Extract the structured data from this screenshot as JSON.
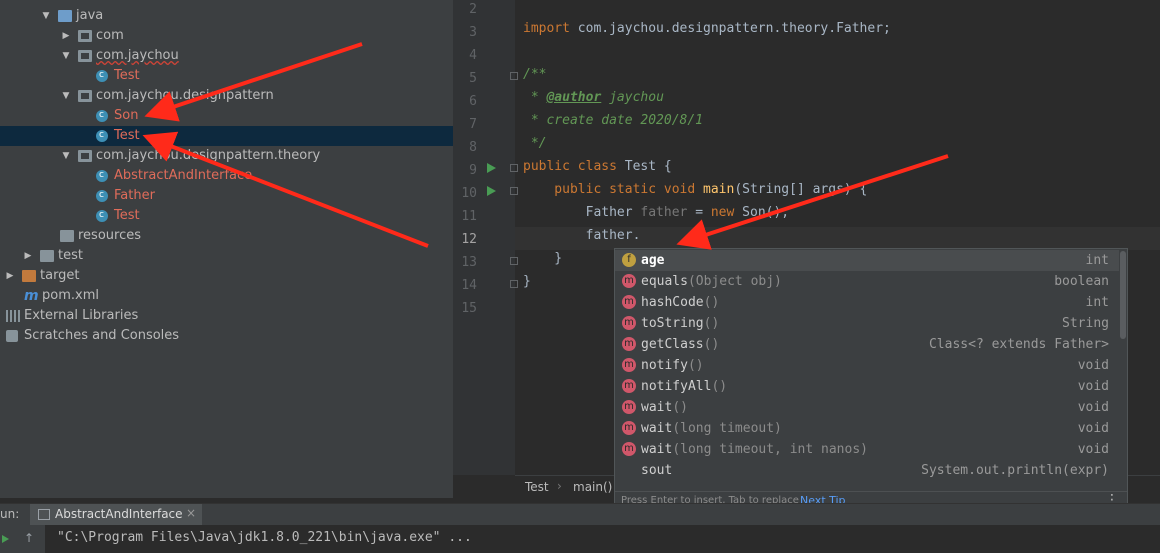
{
  "project_tree": [
    {
      "label": "java",
      "icon": "java-folder-icon",
      "expanded": true
    },
    {
      "label": "com",
      "icon": "package-icon",
      "expanded": false
    },
    {
      "label": "com.jaychou",
      "icon": "package-icon",
      "expanded": true
    },
    {
      "label": "Test",
      "icon": "class-icon"
    },
    {
      "label": "com.jaychou.designpattern",
      "icon": "package-icon",
      "expanded": true
    },
    {
      "label": "Son",
      "icon": "class-icon"
    },
    {
      "label": "Test",
      "icon": "class-icon",
      "selected": true
    },
    {
      "label": "com.jaychou.designpattern.theory",
      "icon": "package-icon",
      "expanded": true
    },
    {
      "label": "AbstractAndInterface",
      "icon": "class-icon"
    },
    {
      "label": "Father",
      "icon": "class-icon"
    },
    {
      "label": "Test",
      "icon": "class-icon"
    },
    {
      "label": "resources",
      "icon": "resources-folder-icon"
    },
    {
      "label": "test",
      "icon": "folder-icon",
      "expanded": false
    },
    {
      "label": "target",
      "icon": "target-folder-icon",
      "expanded": false
    },
    {
      "label": "pom.xml",
      "icon": "maven-icon"
    },
    {
      "label": "External Libraries",
      "icon": "libraries-icon",
      "expanded": false
    },
    {
      "label": "Scratches and Consoles",
      "icon": "scratches-icon",
      "expanded": false
    }
  ],
  "editor": {
    "line_numbers": [
      "2",
      "3",
      "4",
      "5",
      "6",
      "7",
      "8",
      "9",
      "10",
      "11",
      "12",
      "13",
      "14",
      "15"
    ],
    "current_line": "12",
    "code": {
      "import_kw": "import",
      "import_path": " com.jaychou.designpattern.theory.Father;",
      "doc_open": "/**",
      "doc_star1": " * ",
      "doc_author_tag": "@author",
      "doc_author_name": " jaychou",
      "doc_date": " * create date 2020/8/1",
      "doc_close": " */",
      "class_mods": "public class",
      "class_name": " Test {",
      "main_mods": "    public static void",
      "main_name": " main",
      "main_args": "(String[] args) {",
      "father_type": "        Father ",
      "father_var": "father",
      "father_eq": " = ",
      "father_new": "new",
      "father_ctor": " Son();",
      "father_call": "        father.",
      "close_method": "    }",
      "close_class": "}"
    }
  },
  "breadcrumb": {
    "items": [
      "Test",
      "main()"
    ],
    "separator": "›"
  },
  "completion": {
    "items": [
      {
        "kind": "f",
        "name": "age",
        "params": "",
        "type": "int",
        "selected": true
      },
      {
        "kind": "m",
        "name": "equals",
        "params": "(Object obj)",
        "type": "boolean"
      },
      {
        "kind": "m",
        "name": "hashCode",
        "params": "()",
        "type": "int"
      },
      {
        "kind": "m",
        "name": "toString",
        "params": "()",
        "type": "String"
      },
      {
        "kind": "m",
        "name": "getClass",
        "params": "()",
        "type": "Class<? extends Father>"
      },
      {
        "kind": "m",
        "name": "notify",
        "params": "()",
        "type": "void"
      },
      {
        "kind": "m",
        "name": "notifyAll",
        "params": "()",
        "type": "void"
      },
      {
        "kind": "m",
        "name": "wait",
        "params": "()",
        "type": "void"
      },
      {
        "kind": "m",
        "name": "wait",
        "params": "(long timeout)",
        "type": "void"
      },
      {
        "kind": "m",
        "name": "wait",
        "params": "(long timeout, int nanos)",
        "type": "void"
      },
      {
        "kind": "",
        "name": "sout",
        "params": "",
        "type": "System.out.println(expr)"
      }
    ],
    "footer_hint": "Press Enter to insert, Tab to replace",
    "footer_link": "Next Tip",
    "icon_letter_field": "f",
    "icon_letter_method": "m"
  },
  "run_panel": {
    "label": "un:",
    "tab_label": "AbstractAndInterface",
    "tab_close": "×",
    "console_line": "\"C:\\Program Files\\Java\\jdk1.8.0_221\\bin\\java.exe\" ..."
  },
  "colors": {
    "accent": "#589df6",
    "arrow": "#ff2a1a",
    "selection": "#0d293e"
  }
}
